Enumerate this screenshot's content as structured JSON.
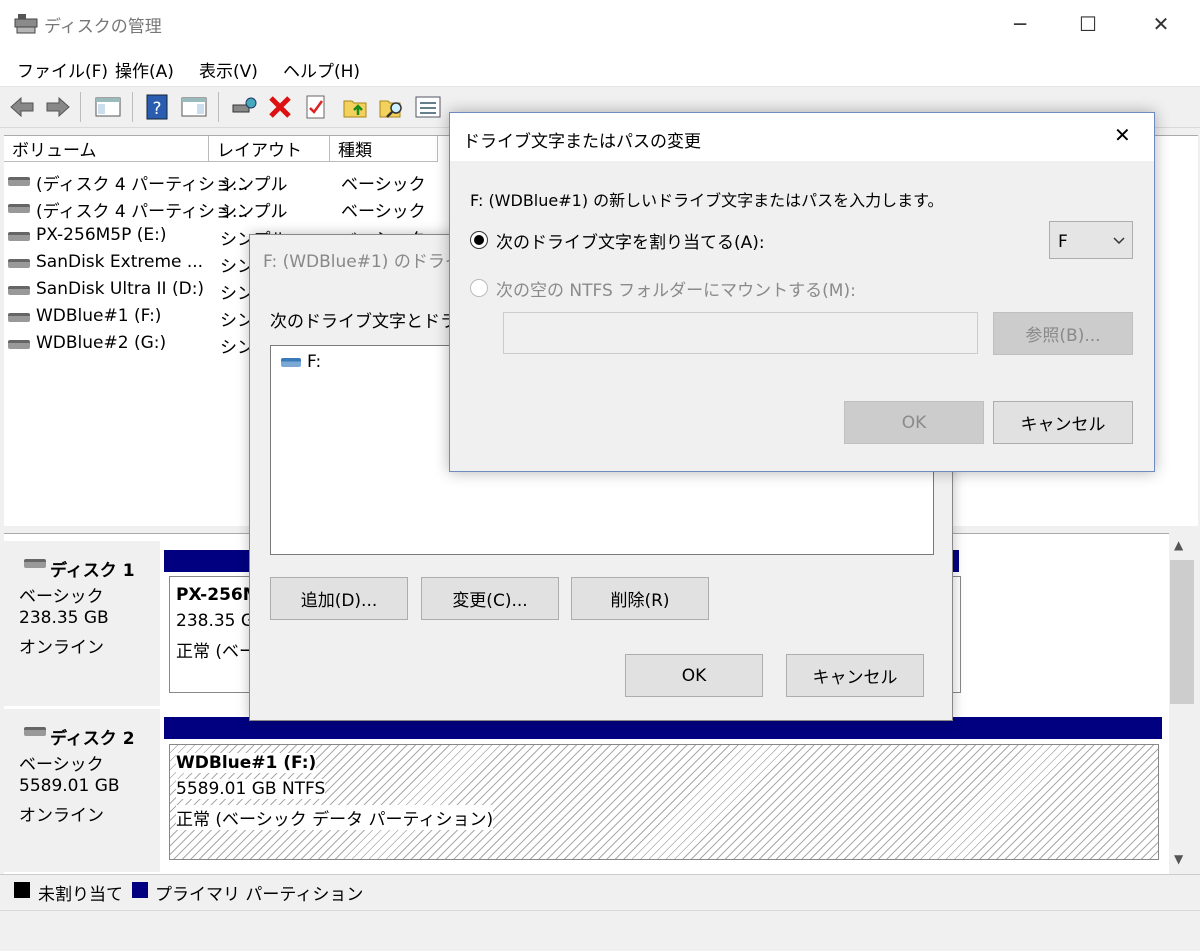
{
  "window": {
    "title": "ディスクの管理",
    "minimize_glyph": "─",
    "maximize_glyph": "☐",
    "close_glyph": "✕"
  },
  "menu": {
    "file": "ファイル(F)",
    "action": "操作(A)",
    "view": "表示(V)",
    "help": "ヘルプ(H)"
  },
  "toolbar": {
    "icons": [
      "back-arrow-icon",
      "forward-arrow-icon",
      "console-tree-icon",
      "help-icon",
      "action-pane-icon",
      "connect-icon",
      "delete-icon",
      "properties-icon",
      "up-folder-icon",
      "search-folder-icon",
      "list-icon"
    ]
  },
  "volume_list": {
    "columns": [
      "ボリューム",
      "レイアウト",
      "種類"
    ],
    "rows": [
      {
        "name": "(ディスク 4 パーティショ...",
        "layout": "シンプル",
        "type": "ベーシック"
      },
      {
        "name": "(ディスク 4 パーティショ...",
        "layout": "シンプル",
        "type": "ベーシック"
      },
      {
        "name": "PX-256M5P (E:)",
        "layout": "シンプル",
        "type": "ベーシック"
      },
      {
        "name": "SanDisk Extreme ...",
        "layout": "シン",
        "type": ""
      },
      {
        "name": "SanDisk Ultra II (D:)",
        "layout": "シン",
        "type": ""
      },
      {
        "name": "WDBlue#1 (F:)",
        "layout": "シン",
        "type": ""
      },
      {
        "name": "WDBlue#2 (G:)",
        "layout": "シン",
        "type": ""
      }
    ]
  },
  "disks": [
    {
      "label": "ディスク 1",
      "type": "ベーシック",
      "size": "238.35 GB",
      "status": "オンライン",
      "partition": {
        "name": "PX-256M",
        "size": "238.35 G",
        "state": "正常 (ベー"
      }
    },
    {
      "label": "ディスク 2",
      "type": "ベーシック",
      "size": "5589.01 GB",
      "status": "オンライン",
      "partition": {
        "name": "WDBlue#1  (F:)",
        "size": "5589.01 GB NTFS",
        "state": "正常 (ベーシック データ パーティション)"
      }
    }
  ],
  "legend": {
    "unallocated": "未割り当て",
    "primary": "プライマリ パーティション",
    "unallocated_color": "#000000",
    "primary_color": "#000080"
  },
  "dialog_paths": {
    "title": "F: (WDBlue#1) のドライ",
    "instruction": "次のドライブ文字とドライ",
    "item": "F:",
    "add": "追加(D)...",
    "change": "変更(C)...",
    "remove": "削除(R)",
    "ok": "OK",
    "cancel": "キャンセル"
  },
  "dialog_change": {
    "title": "ドライブ文字またはパスの変更",
    "instruction": "F: (WDBlue#1) の新しいドライブ文字またはパスを入力します。",
    "assign_label": "次のドライブ文字を割り当てる(A):",
    "assign_selected": true,
    "letter": "F",
    "mount_label": "次の空の NTFS フォルダーにマウントする(M):",
    "mount_path": "",
    "browse": "参照(B)...",
    "ok": "OK",
    "cancel": "キャンセル",
    "close_glyph": "✕"
  }
}
